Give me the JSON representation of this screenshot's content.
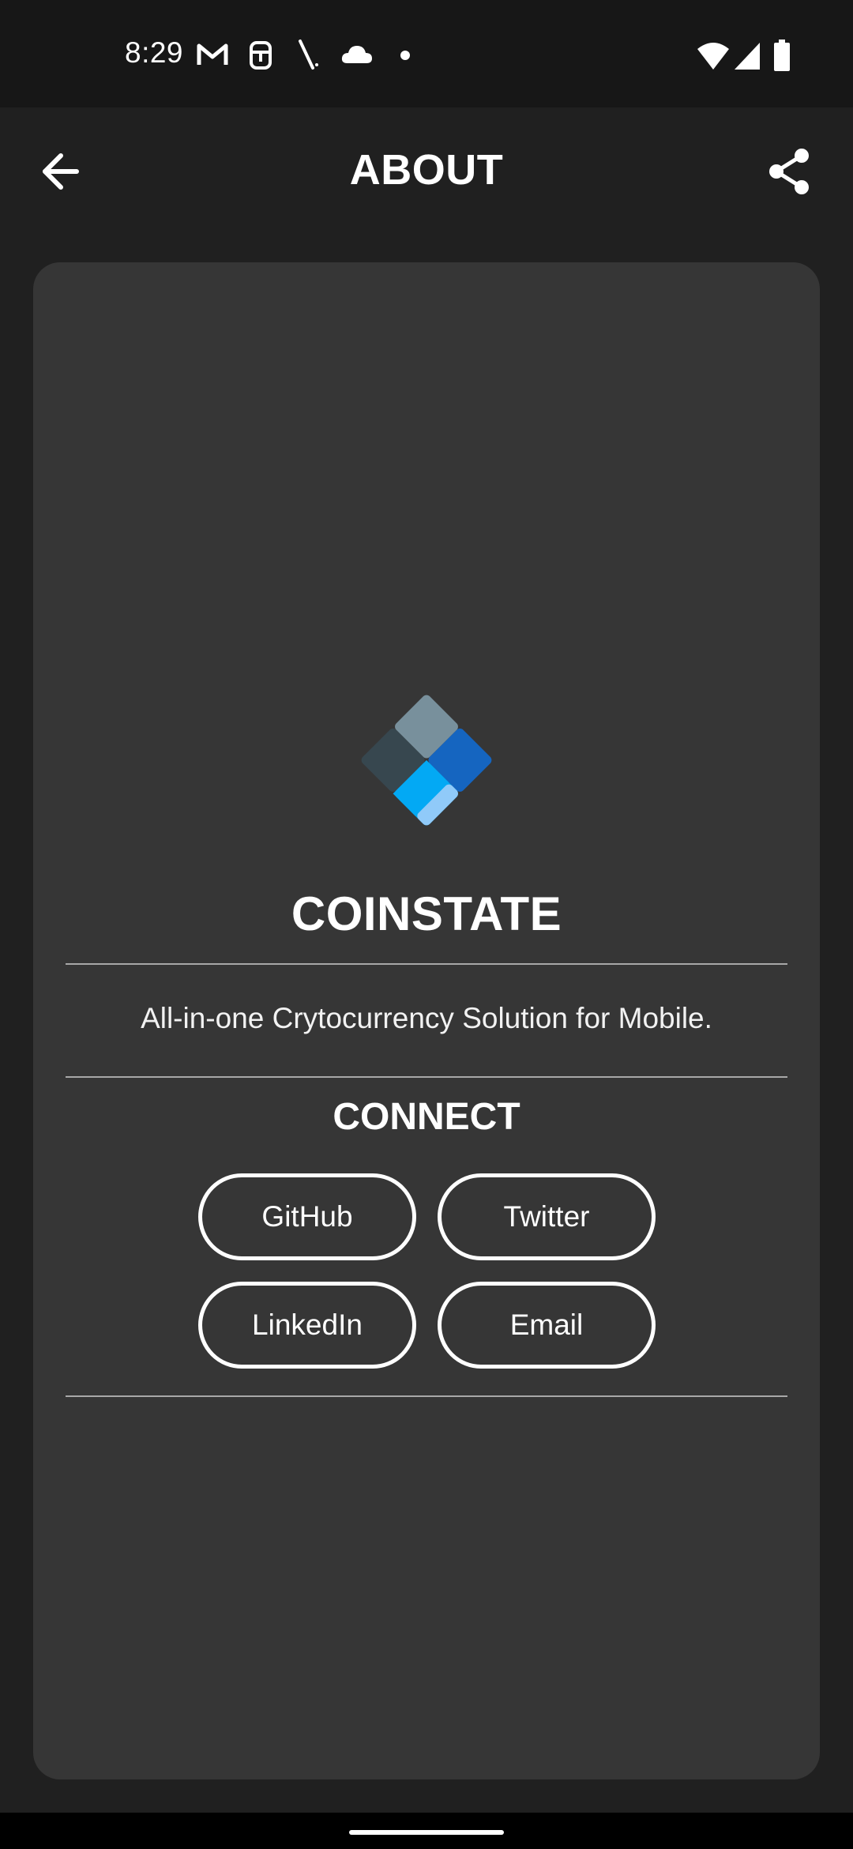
{
  "status_bar": {
    "time": "8:29",
    "left_icons": [
      "gmail-icon",
      "screenshot-lock-icon",
      "signal-tower-icon",
      "cloud-icon",
      "dot-icon"
    ],
    "right_icons": [
      "wifi-icon",
      "cell-signal-icon",
      "battery-icon"
    ]
  },
  "app_bar": {
    "title": "ABOUT",
    "back_icon": "arrow-back-icon",
    "share_icon": "share-icon"
  },
  "card": {
    "app_name": "COINSTATE",
    "tagline": "All-in-one Crytocurrency Solution for Mobile.",
    "connect_heading": "CONNECT",
    "buttons": [
      {
        "label": "GitHub"
      },
      {
        "label": "Twitter"
      },
      {
        "label": "LinkedIn"
      },
      {
        "label": "Email"
      }
    ]
  },
  "colors": {
    "background": "#202020",
    "status_bar": "#171717",
    "card": "#363636",
    "logo_light_blue": "#03A9F4",
    "logo_dark_blue": "#1565C0",
    "logo_pale_blue": "#90CAF9",
    "logo_gray": "#78909C",
    "logo_dark_gray": "#37474F"
  }
}
